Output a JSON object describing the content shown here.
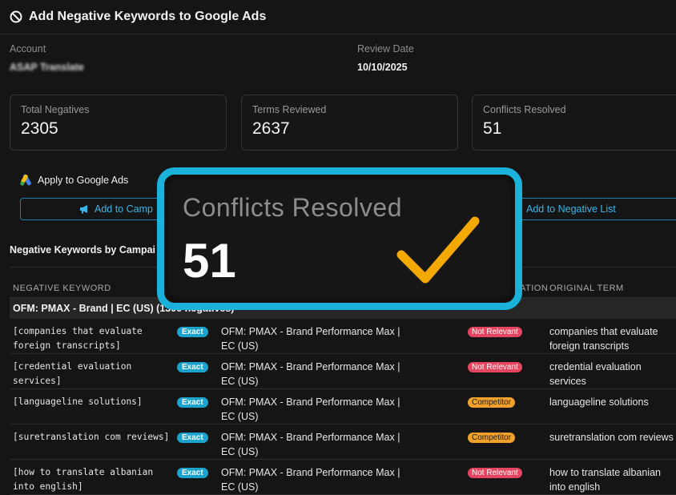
{
  "header": {
    "title": "Add Negative Keywords to Google Ads",
    "icon": "ban-icon"
  },
  "meta": {
    "account_label": "Account",
    "account_value": "ASAP Translate",
    "review_label": "Review Date",
    "review_value": "10/10/2025"
  },
  "stats": [
    {
      "label": "Total Negatives",
      "value": "2305"
    },
    {
      "label": "Terms Reviewed",
      "value": "2637"
    },
    {
      "label": "Conflicts Resolved",
      "value": "51"
    }
  ],
  "apply": {
    "label": "Apply to Google Ads",
    "icon": "google-ads-icon"
  },
  "buttons": {
    "add_campaign": "Add to Camp",
    "add_negative_list": "Add to Negative List"
  },
  "section_title": "Negative Keywords by Campai",
  "table": {
    "headers": {
      "keyword": "NEGATIVE KEYWORD",
      "reason": "ATION",
      "original": "ORIGINAL TERM"
    },
    "group": "OFM: PMAX - Brand | EC (US) (1300 negatives)",
    "rows": [
      {
        "keyword": "[companies that evaluate foreign transcripts]",
        "match": "Exact",
        "campaign": "OFM: PMAX - Brand  Performance Max | EC (US)",
        "reason": "Not Relevant",
        "original": "companies that evaluate foreign transcripts"
      },
      {
        "keyword": "[credential evaluation services]",
        "match": "Exact",
        "campaign": "OFM: PMAX - Brand  Performance Max | EC (US)",
        "reason": "Not Relevant",
        "original": "credential evaluation services"
      },
      {
        "keyword": "[languageline solutions]",
        "match": "Exact",
        "campaign": "OFM: PMAX - Brand  Performance Max | EC (US)",
        "reason": "Competitor",
        "original": "languageline solutions"
      },
      {
        "keyword": "[suretranslation com reviews]",
        "match": "Exact",
        "campaign": "OFM: PMAX - Brand  Performance Max | EC (US)",
        "reason": "Competitor",
        "original": "suretranslation com reviews"
      },
      {
        "keyword": "[how to translate albanian into english]",
        "match": "Exact",
        "campaign": "OFM: PMAX - Brand  Performance Max | EC (US)",
        "reason": "Not Relevant",
        "original": "how to translate albanian into english"
      }
    ]
  },
  "callout": {
    "label": "Conflicts Resolved",
    "value": "51",
    "icon": "checkmark-icon"
  },
  "colors": {
    "accent": "#1ab2da",
    "check": "#f4a900",
    "not_relevant": "#e5455e",
    "competitor": "#f1a12a"
  }
}
